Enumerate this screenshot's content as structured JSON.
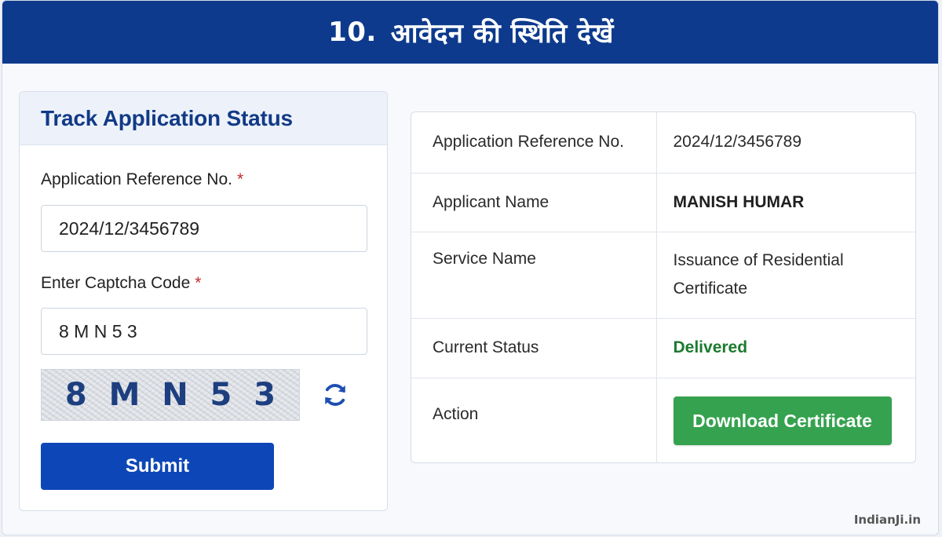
{
  "banner": {
    "number": "10.",
    "title": "आवेदन की स्थिति देखें"
  },
  "form": {
    "heading": "Track Application Status",
    "reference_label": "Application Reference No.",
    "reference_value": "2024/12/3456789",
    "captcha_label": "Enter Captcha Code",
    "captcha_value": "8 M N 5 3",
    "required_mark": "*",
    "captcha_chars": [
      "8",
      "M",
      "N",
      "5",
      "3"
    ],
    "submit_label": "Submit"
  },
  "result": {
    "rows": [
      {
        "key": "Application Reference No.",
        "value": "2024/12/3456789"
      },
      {
        "key": "Applicant Name",
        "value": "MANISH HUMAR"
      },
      {
        "key": "Service Name",
        "value": "Issuance of Residential Certificate"
      },
      {
        "key": "Current Status",
        "value": "Delivered"
      },
      {
        "key": "Action",
        "value": ""
      }
    ],
    "download_label": "Download Certificate"
  },
  "watermark": "IndianJi.in",
  "colors": {
    "banner_bg": "#0d3a8c",
    "submit_bg": "#0d47b7",
    "download_bg": "#35a24f",
    "status_color": "#1c7a2e",
    "required_color": "#c0292b"
  },
  "icons": {
    "refresh": "refresh-icon"
  }
}
